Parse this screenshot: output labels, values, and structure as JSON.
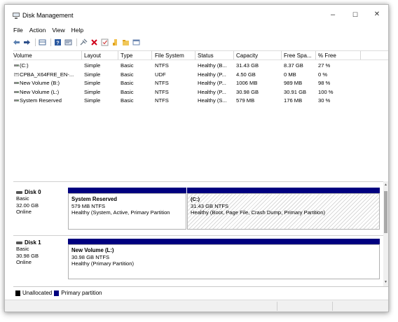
{
  "window": {
    "title": "Disk Management",
    "minimize_glyph": "–",
    "maximize_glyph": "☐",
    "close_glyph": "✕"
  },
  "menu": [
    "File",
    "Action",
    "View",
    "Help"
  ],
  "toolbar": {
    "icons": [
      "back-arrow-icon",
      "forward-arrow-icon",
      "disk-list-icon",
      "help-icon",
      "properties-icon",
      "connect-icon",
      "delete-icon",
      "check-icon",
      "folder-icon",
      "open-folder-icon",
      "console-icon"
    ]
  },
  "volumes": {
    "columns": [
      "Volume",
      "Layout",
      "Type",
      "File System",
      "Status",
      "Capacity",
      "Free Spa...",
      "% Free"
    ],
    "rows": [
      {
        "volume": "(C:)",
        "layout": "Simple",
        "type": "Basic",
        "fs": "NTFS",
        "status": "Healthy (B...",
        "capacity": "31.43 GB",
        "free": "8.37 GB",
        "pct": "27 %",
        "icon": "drive-icon"
      },
      {
        "volume": "CPBA_X64FRE_EN-...",
        "layout": "Simple",
        "type": "Basic",
        "fs": "UDF",
        "status": "Healthy (P...",
        "capacity": "4.50 GB",
        "free": "0 MB",
        "pct": "0 %",
        "icon": "optical-drive-icon"
      },
      {
        "volume": "New Volume (B:)",
        "layout": "Simple",
        "type": "Basic",
        "fs": "NTFS",
        "status": "Healthy (P...",
        "capacity": "1006 MB",
        "free": "989 MB",
        "pct": "98 %",
        "icon": "drive-icon"
      },
      {
        "volume": "New Volume (L:)",
        "layout": "Simple",
        "type": "Basic",
        "fs": "NTFS",
        "status": "Healthy (P...",
        "capacity": "30.98 GB",
        "free": "30.91 GB",
        "pct": "100 %",
        "icon": "drive-icon"
      },
      {
        "volume": "System Reserved",
        "layout": "Simple",
        "type": "Basic",
        "fs": "NTFS",
        "status": "Healthy (S...",
        "capacity": "579 MB",
        "free": "176 MB",
        "pct": "30 %",
        "icon": "drive-icon"
      }
    ]
  },
  "disks": [
    {
      "name": "Disk 0",
      "type": "Basic",
      "size": "32.00 GB",
      "state": "Online",
      "partitions": [
        {
          "title": "System Reserved",
          "size": "579 MB NTFS",
          "status": "Healthy (System, Active, Primary Partition"
        },
        {
          "title": "(C:)",
          "size": "31.43 GB NTFS",
          "status": "Healthy (Boot, Page File, Crash Dump, Primary Partition)"
        }
      ]
    },
    {
      "name": "Disk 1",
      "type": "Basic",
      "size": "30.98 GB",
      "state": "Online",
      "partitions": [
        {
          "title": "New Volume  (L:)",
          "size": "30.98 GB NTFS",
          "status": "Healthy (Primary Partition)"
        }
      ]
    }
  ],
  "legend": [
    {
      "label": "Unallocated",
      "color": "#000000"
    },
    {
      "label": "Primary partition",
      "color": "#00007f"
    }
  ],
  "colors": {
    "primary_partition": "#00007f",
    "unallocated": "#000000"
  }
}
